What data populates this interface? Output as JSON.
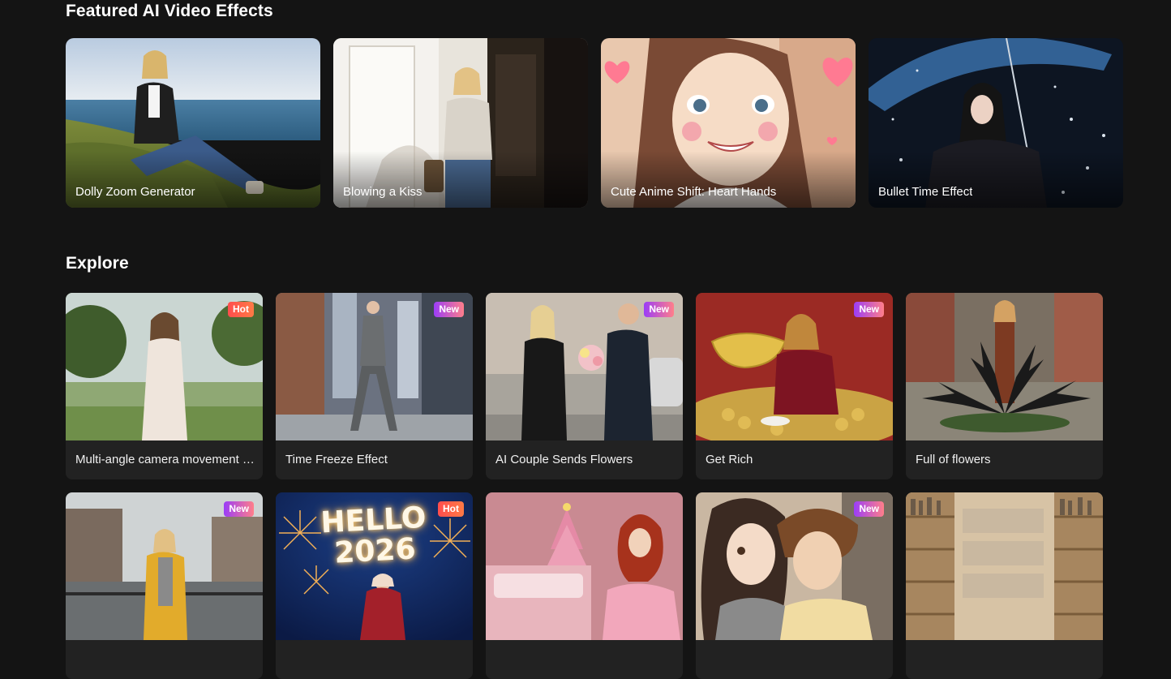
{
  "featured": {
    "title": "Featured AI Video Effects",
    "cards": [
      {
        "label": "Dolly Zoom Generator"
      },
      {
        "label": "Blowing a Kiss"
      },
      {
        "label": "Cute Anime Shift: Heart Hands"
      },
      {
        "label": "Bullet Time Effect"
      }
    ]
  },
  "explore": {
    "title": "Explore",
    "cards": [
      {
        "label": "Multi-angle camera movement video",
        "badge": "Hot"
      },
      {
        "label": "Time Freeze Effect",
        "badge": "New"
      },
      {
        "label": "AI Couple Sends Flowers",
        "badge": "New"
      },
      {
        "label": "Get Rich",
        "badge": "New"
      },
      {
        "label": "Full of flowers",
        "badge": ""
      },
      {
        "label": "",
        "badge": "New"
      },
      {
        "label": "",
        "badge": "Hot",
        "overlay_text": "HELLO\n2026"
      },
      {
        "label": "",
        "badge": ""
      },
      {
        "label": "",
        "badge": "New"
      },
      {
        "label": "",
        "badge": ""
      }
    ]
  },
  "colors": {
    "background": "#141414",
    "card_background": "#222222",
    "badge_hot": "#ff5a4a",
    "badge_new_start": "#9b3df7",
    "badge_new_end": "#ff7e8a"
  }
}
